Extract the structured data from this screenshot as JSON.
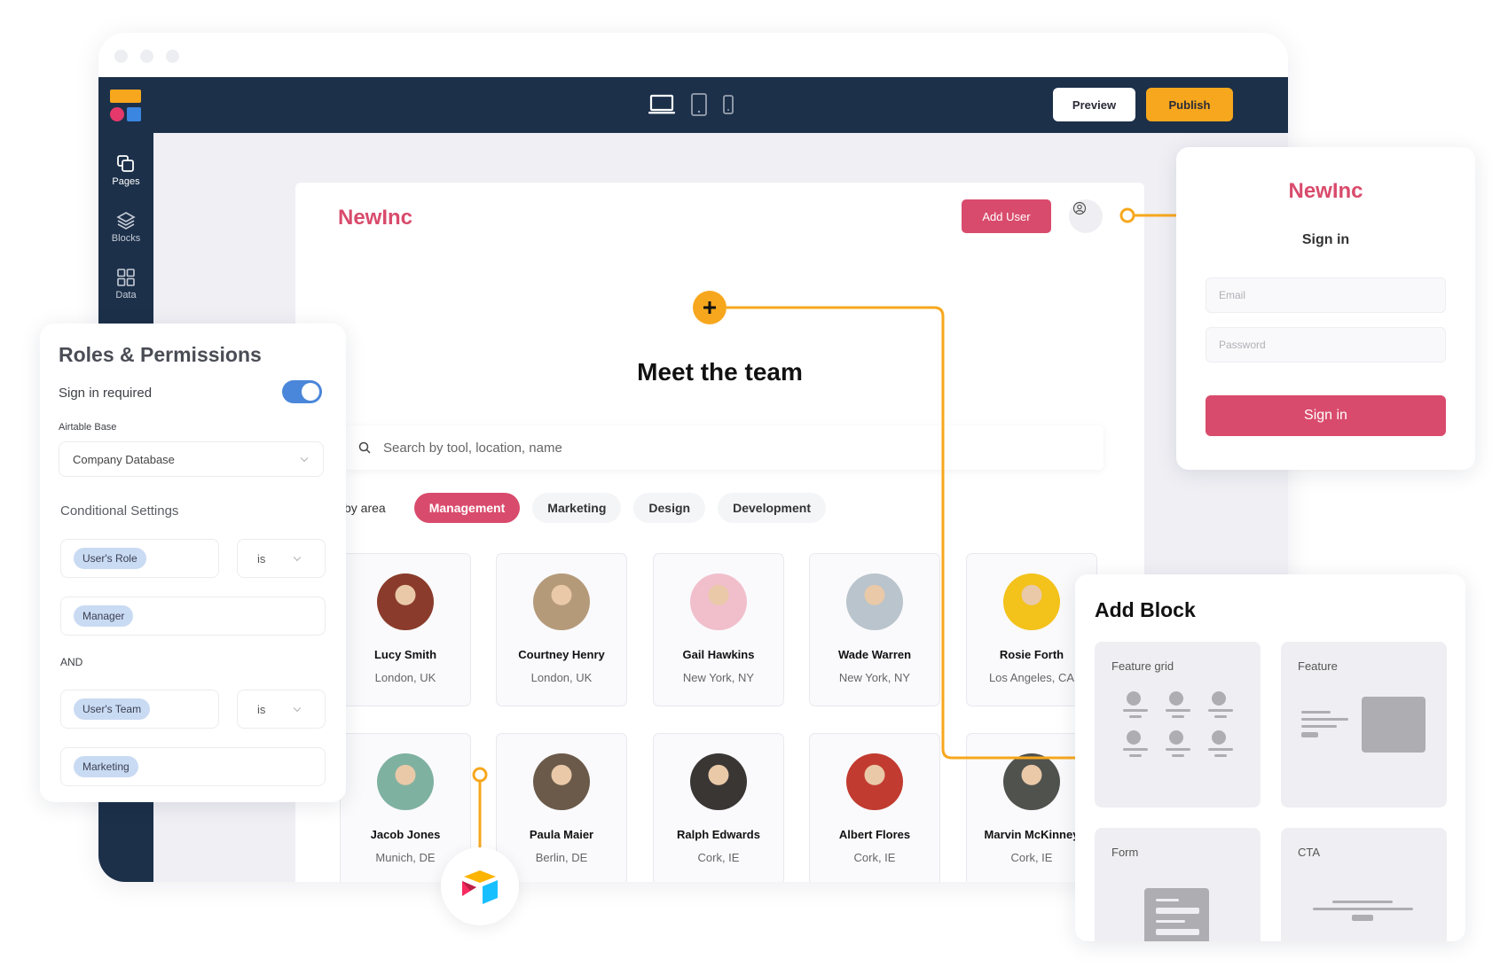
{
  "app": {
    "device_modes": [
      "desktop",
      "tablet",
      "mobile"
    ],
    "active_device": "desktop",
    "preview_label": "Preview",
    "publish_label": "Publish",
    "sidebar": [
      {
        "label": "Pages",
        "icon": "pages-icon"
      },
      {
        "label": "Blocks",
        "icon": "blocks-icon"
      },
      {
        "label": "Data",
        "icon": "data-icon"
      }
    ]
  },
  "page": {
    "brand": "NewInc",
    "add_user_label": "Add User",
    "title": "Meet the team",
    "search_placeholder": "Search by tool, location, name",
    "filter_label": "Filter by area",
    "filters": [
      {
        "label": "Management",
        "active": true
      },
      {
        "label": "Marketing",
        "active": false
      },
      {
        "label": "Design",
        "active": false
      },
      {
        "label": "Development",
        "active": false
      }
    ],
    "team": [
      {
        "name": "Lucy Smith",
        "location": "London, UK",
        "color": "#8a3b2b"
      },
      {
        "name": "Courtney Henry",
        "location": "London, UK",
        "color": "#b59a7a"
      },
      {
        "name": "Gail Hawkins",
        "location": "New York, NY",
        "color": "#f1bfcc"
      },
      {
        "name": "Wade Warren",
        "location": "New York, NY",
        "color": "#b9c4cc"
      },
      {
        "name": "Rosie Forth",
        "location": "Los Angeles, CA",
        "color": "#f3c21b"
      },
      {
        "name": "Jacob Jones",
        "location": "Munich, DE",
        "color": "#7fb1a0"
      },
      {
        "name": "Paula Maier",
        "location": "Berlin, DE",
        "color": "#6b5a4a"
      },
      {
        "name": "Ralph Edwards",
        "location": "Cork, IE",
        "color": "#3a3634"
      },
      {
        "name": "Albert Flores",
        "location": "Cork, IE",
        "color": "#c23b30"
      },
      {
        "name": "Marvin McKinney",
        "location": "Cork, IE",
        "color": "#50524e"
      }
    ]
  },
  "roles": {
    "title": "Roles & Permissions",
    "sign_in_label": "Sign in required",
    "sign_in_required": true,
    "base_label": "Airtable Base",
    "base_value": "Company Database",
    "conditional_title": "Conditional Settings",
    "conditions": [
      {
        "field": "User's Role",
        "operator": "is",
        "value": "Manager"
      },
      {
        "field": "User's Team",
        "operator": "is",
        "value": "Marketing"
      }
    ],
    "joiner": "AND"
  },
  "signin": {
    "brand": "NewInc",
    "title": "Sign in",
    "email_placeholder": "Email",
    "password_placeholder": "Password",
    "button_label": "Sign in"
  },
  "add_block": {
    "title": "Add Block",
    "blocks": [
      "Feature grid",
      "Feature",
      "Form",
      "CTA"
    ]
  },
  "colors": {
    "navy": "#1c304a",
    "brand_pink": "#d94b6c",
    "accent_orange": "#f7a71d",
    "toggle_blue": "#4a86d9"
  }
}
